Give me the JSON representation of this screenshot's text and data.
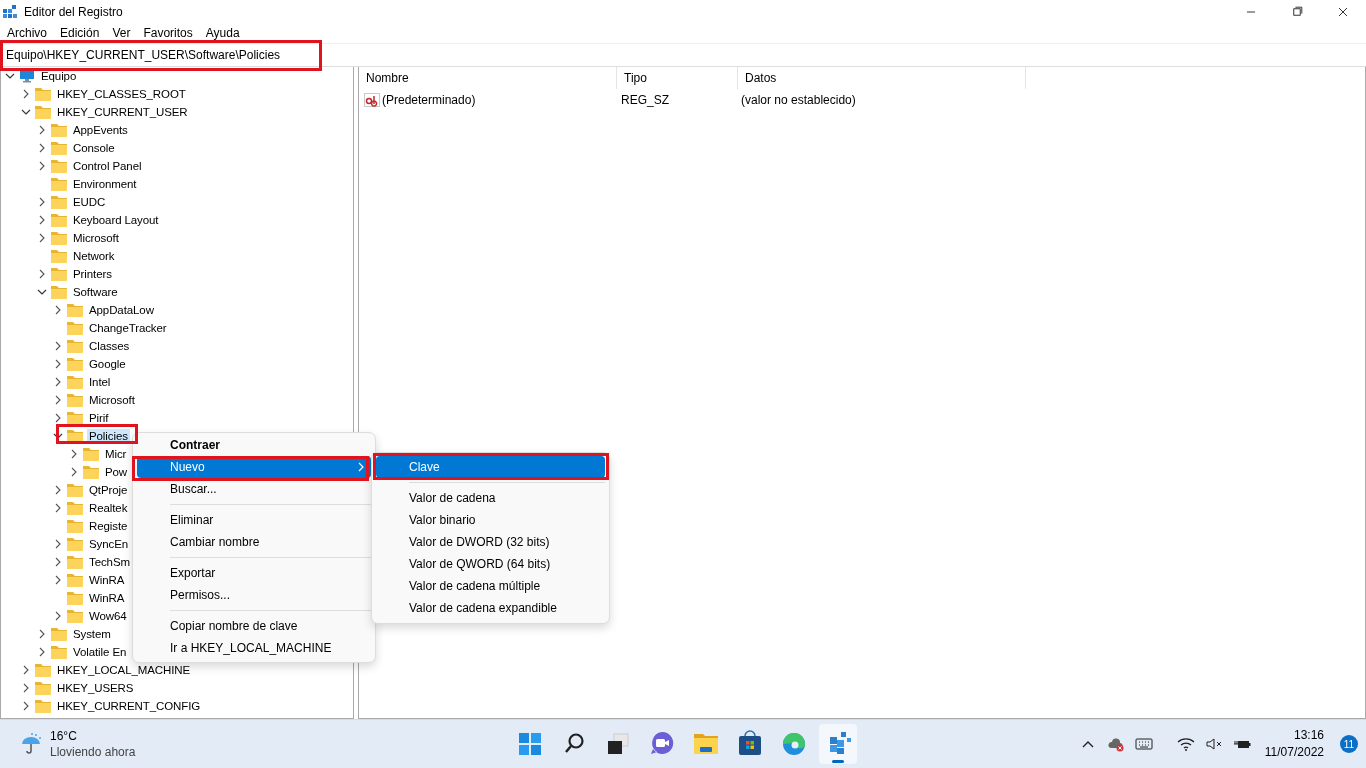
{
  "window": {
    "title": "Editor del Registro"
  },
  "menu_bar": [
    "Archivo",
    "Edición",
    "Ver",
    "Favoritos",
    "Ayuda"
  ],
  "address_bar": {
    "value": "Equipo\\HKEY_CURRENT_USER\\Software\\Policies"
  },
  "tree": [
    {
      "label": "Equipo",
      "kind": "computer",
      "expanded": true,
      "selected": false,
      "children": [
        {
          "label": "HKEY_CLASSES_ROOT",
          "kind": "branch",
          "expanded": false,
          "selected": false
        },
        {
          "label": "HKEY_CURRENT_USER",
          "kind": "branch",
          "expanded": true,
          "selected": false,
          "children": [
            {
              "label": "AppEvents",
              "kind": "branch",
              "expanded": false,
              "selected": false
            },
            {
              "label": "Console",
              "kind": "branch",
              "expanded": false,
              "selected": false
            },
            {
              "label": "Control Panel",
              "kind": "branch",
              "expanded": false,
              "selected": false
            },
            {
              "label": "Environment",
              "kind": "leaf",
              "selected": false
            },
            {
              "label": "EUDC",
              "kind": "branch",
              "expanded": false,
              "selected": false
            },
            {
              "label": "Keyboard Layout",
              "kind": "branch",
              "expanded": false,
              "selected": false
            },
            {
              "label": "Microsoft",
              "kind": "branch",
              "expanded": false,
              "selected": false
            },
            {
              "label": "Network",
              "kind": "leaf",
              "selected": false
            },
            {
              "label": "Printers",
              "kind": "branch",
              "expanded": false,
              "selected": false
            },
            {
              "label": "Software",
              "kind": "branch",
              "expanded": true,
              "selected": false,
              "children": [
                {
                  "label": "AppDataLow",
                  "kind": "branch",
                  "expanded": false,
                  "selected": false
                },
                {
                  "label": "ChangeTracker",
                  "kind": "leaf",
                  "selected": false
                },
                {
                  "label": "Classes",
                  "kind": "branch",
                  "expanded": false,
                  "selected": false
                },
                {
                  "label": "Google",
                  "kind": "branch",
                  "expanded": false,
                  "selected": false
                },
                {
                  "label": "Intel",
                  "kind": "branch",
                  "expanded": false,
                  "selected": false
                },
                {
                  "label": "Microsoft",
                  "kind": "branch",
                  "expanded": false,
                  "selected": false
                },
                {
                  "label": "Pirif",
                  "kind": "branch",
                  "expanded": false,
                  "selected": false
                },
                {
                  "label": "Policies",
                  "kind": "branch",
                  "expanded": true,
                  "selected": true,
                  "children": [
                    {
                      "label": "Micr",
                      "kind": "branch",
                      "expanded": false,
                      "selected": false
                    },
                    {
                      "label": "Pow",
                      "kind": "branch",
                      "expanded": false,
                      "selected": false
                    }
                  ]
                },
                {
                  "label": "QtProje",
                  "kind": "branch",
                  "expanded": false,
                  "selected": false
                },
                {
                  "label": "Realtek",
                  "kind": "branch",
                  "expanded": false,
                  "selected": false
                },
                {
                  "label": "Registe",
                  "kind": "leaf",
                  "selected": false
                },
                {
                  "label": "SyncEn",
                  "kind": "branch",
                  "expanded": false,
                  "selected": false
                },
                {
                  "label": "TechSm",
                  "kind": "branch",
                  "expanded": false,
                  "selected": false
                },
                {
                  "label": "WinRA",
                  "kind": "branch",
                  "expanded": false,
                  "selected": false
                },
                {
                  "label": "WinRA",
                  "kind": "leaf",
                  "selected": false
                },
                {
                  "label": "Wow64",
                  "kind": "branch",
                  "expanded": false,
                  "selected": false
                }
              ]
            },
            {
              "label": "System",
              "kind": "branch",
              "expanded": false,
              "selected": false
            },
            {
              "label": "Volatile En",
              "kind": "branch",
              "expanded": false,
              "selected": false
            }
          ]
        },
        {
          "label": "HKEY_LOCAL_MACHINE",
          "kind": "branch",
          "expanded": false,
          "selected": false
        },
        {
          "label": "HKEY_USERS",
          "kind": "branch",
          "expanded": false,
          "selected": false
        },
        {
          "label": "HKEY_CURRENT_CONFIG",
          "kind": "branch",
          "expanded": false,
          "selected": false
        }
      ]
    }
  ],
  "list": {
    "columns": [
      "Nombre",
      "Tipo",
      "Datos"
    ],
    "rows": [
      {
        "name": "(Predeterminado)",
        "type": "REG_SZ",
        "data": "(valor no establecido)"
      }
    ]
  },
  "context_menu": {
    "items": [
      {
        "kind": "item",
        "label": "Contraer",
        "bold": true,
        "highlighted": false,
        "submenu": false
      },
      {
        "kind": "item",
        "label": "Nuevo",
        "bold": false,
        "highlighted": true,
        "submenu": true
      },
      {
        "kind": "item",
        "label": "Buscar...",
        "bold": false,
        "highlighted": false,
        "submenu": false
      },
      {
        "kind": "separator"
      },
      {
        "kind": "item",
        "label": "Eliminar",
        "bold": false,
        "highlighted": false,
        "submenu": false
      },
      {
        "kind": "item",
        "label": "Cambiar nombre",
        "bold": false,
        "highlighted": false,
        "submenu": false
      },
      {
        "kind": "separator"
      },
      {
        "kind": "item",
        "label": "Exportar",
        "bold": false,
        "highlighted": false,
        "submenu": false
      },
      {
        "kind": "item",
        "label": "Permisos...",
        "bold": false,
        "highlighted": false,
        "submenu": false
      },
      {
        "kind": "separator"
      },
      {
        "kind": "item",
        "label": "Copiar nombre de clave",
        "bold": false,
        "highlighted": false,
        "submenu": false
      },
      {
        "kind": "item",
        "label": "Ir a HKEY_LOCAL_MACHINE",
        "bold": false,
        "highlighted": false,
        "submenu": false
      }
    ]
  },
  "submenu": {
    "items": [
      {
        "kind": "item",
        "label": "Clave",
        "highlighted": true
      },
      {
        "kind": "separator"
      },
      {
        "kind": "item",
        "label": "Valor de cadena",
        "highlighted": false
      },
      {
        "kind": "item",
        "label": "Valor binario",
        "highlighted": false
      },
      {
        "kind": "item",
        "label": "Valor de DWORD (32 bits)",
        "highlighted": false
      },
      {
        "kind": "item",
        "label": "Valor de QWORD (64 bits)",
        "highlighted": false
      },
      {
        "kind": "item",
        "label": "Valor de cadena múltiple",
        "highlighted": false
      },
      {
        "kind": "item",
        "label": "Valor de cadena expandible",
        "highlighted": false
      }
    ]
  },
  "taskbar": {
    "weather": {
      "temperature": "16°C",
      "condition": "Lloviendo ahora"
    },
    "apps": [
      {
        "kind": "start",
        "active": false
      },
      {
        "kind": "search",
        "active": false
      },
      {
        "kind": "taskview",
        "active": false
      },
      {
        "kind": "chat",
        "active": false
      },
      {
        "kind": "explorer",
        "active": false
      },
      {
        "kind": "store",
        "active": false
      },
      {
        "kind": "edge",
        "active": false
      },
      {
        "kind": "regedit",
        "active": true
      }
    ],
    "time": "13:16",
    "date": "11/07/2022",
    "notifications": "11"
  }
}
